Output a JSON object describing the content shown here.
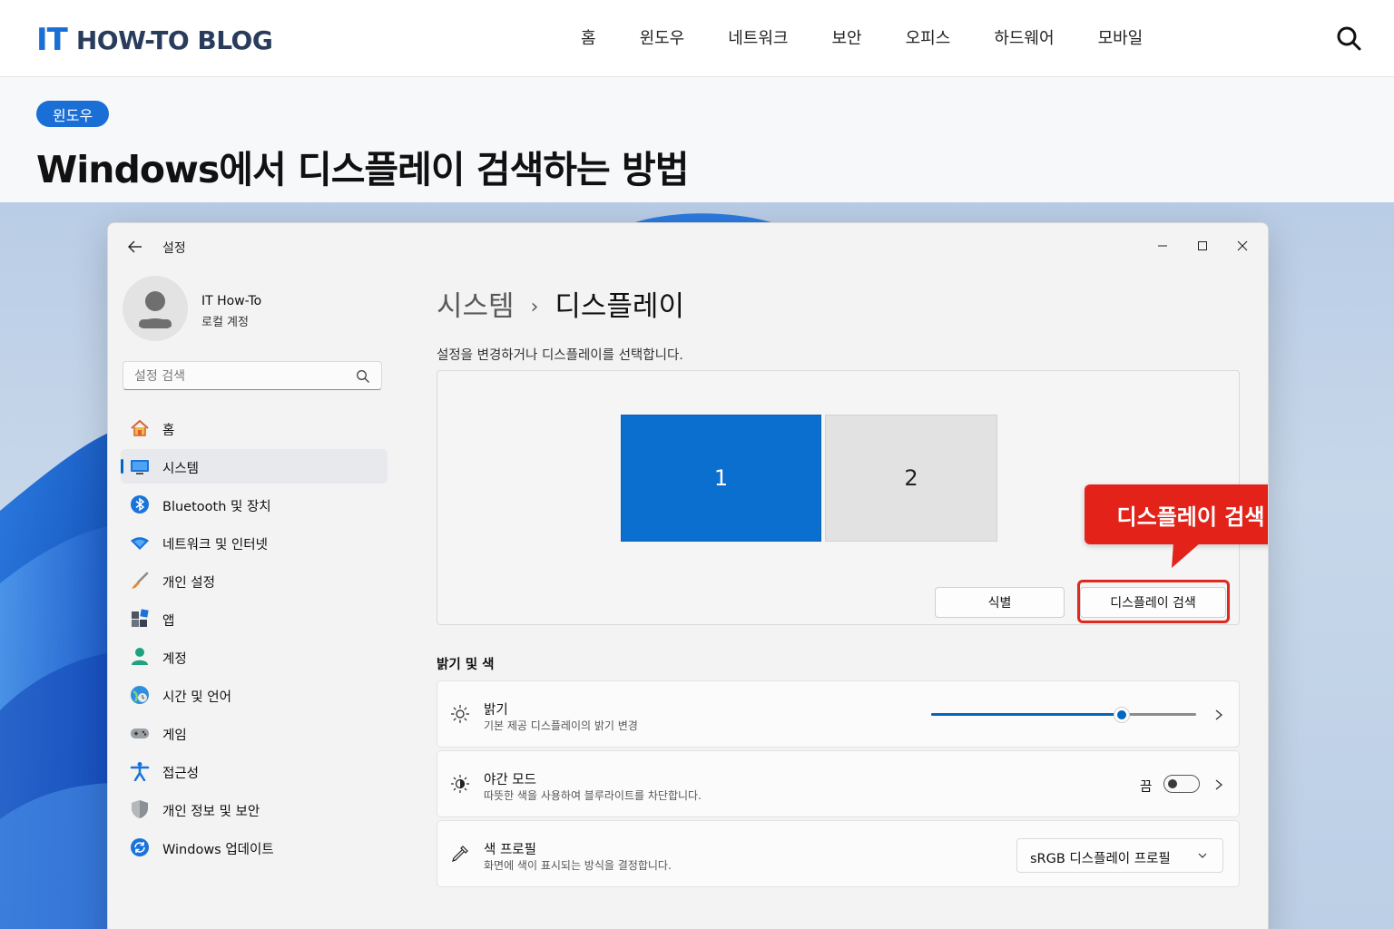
{
  "site": {
    "logo_it": "IT",
    "logo_rest": "HOW-TO BLOG",
    "nav": [
      "홈",
      "윈도우",
      "네트워크",
      "보안",
      "오피스",
      "하드웨어",
      "모바일"
    ]
  },
  "article": {
    "category": "윈도우",
    "title": "Windows에서 디스플레이 검색하는 방법"
  },
  "settings": {
    "window_title": "설정",
    "profile": {
      "name": "IT How-To",
      "account_type": "로컬 계정"
    },
    "search": {
      "placeholder": "설정 검색"
    },
    "nav": [
      {
        "label": "홈",
        "icon": "home-icon"
      },
      {
        "label": "시스템",
        "icon": "system-icon",
        "active": true
      },
      {
        "label": "Bluetooth 및 장치",
        "icon": "bluetooth-icon"
      },
      {
        "label": "네트워크 및 인터넷",
        "icon": "wifi-icon"
      },
      {
        "label": "개인 설정",
        "icon": "brush-icon"
      },
      {
        "label": "앱",
        "icon": "apps-icon"
      },
      {
        "label": "계정",
        "icon": "account-icon"
      },
      {
        "label": "시간 및 언어",
        "icon": "globe-clock-icon"
      },
      {
        "label": "게임",
        "icon": "gamepad-icon"
      },
      {
        "label": "접근성",
        "icon": "accessibility-icon"
      },
      {
        "label": "개인 정보 및 보안",
        "icon": "shield-icon"
      },
      {
        "label": "Windows 업데이트",
        "icon": "update-icon"
      }
    ],
    "breadcrumb": {
      "parent": "시스템",
      "separator": "›",
      "current": "디스플레이"
    },
    "description": "설정을 변경하거나 디스플레이를 선택합니다.",
    "monitors": [
      {
        "label": "1",
        "selected": true
      },
      {
        "label": "2",
        "selected": false
      }
    ],
    "buttons": {
      "identify": "식별",
      "detect": "디스플레이 검색"
    },
    "callout": "디스플레이 검색",
    "section_title": "밝기 및 색",
    "brightness": {
      "title": "밝기",
      "subtitle": "기본 제공 디스플레이의 밝기 변경",
      "level": 0.72
    },
    "night_mode": {
      "title": "야간 모드",
      "subtitle": "따뜻한 색을 사용하여 블루라이트를 차단합니다.",
      "state_label": "끔",
      "on": false
    },
    "color_profile": {
      "title": "색 프로필",
      "subtitle": "화면에 색이 표시되는 방식을 결정합니다.",
      "value": "sRGB 디스플레이 프로필"
    },
    "colors": {
      "accent": "#0067c0",
      "monitor_selected": "#0b6fd0",
      "callout": "#e3231a",
      "brand_blue": "#1a6fd6"
    }
  }
}
